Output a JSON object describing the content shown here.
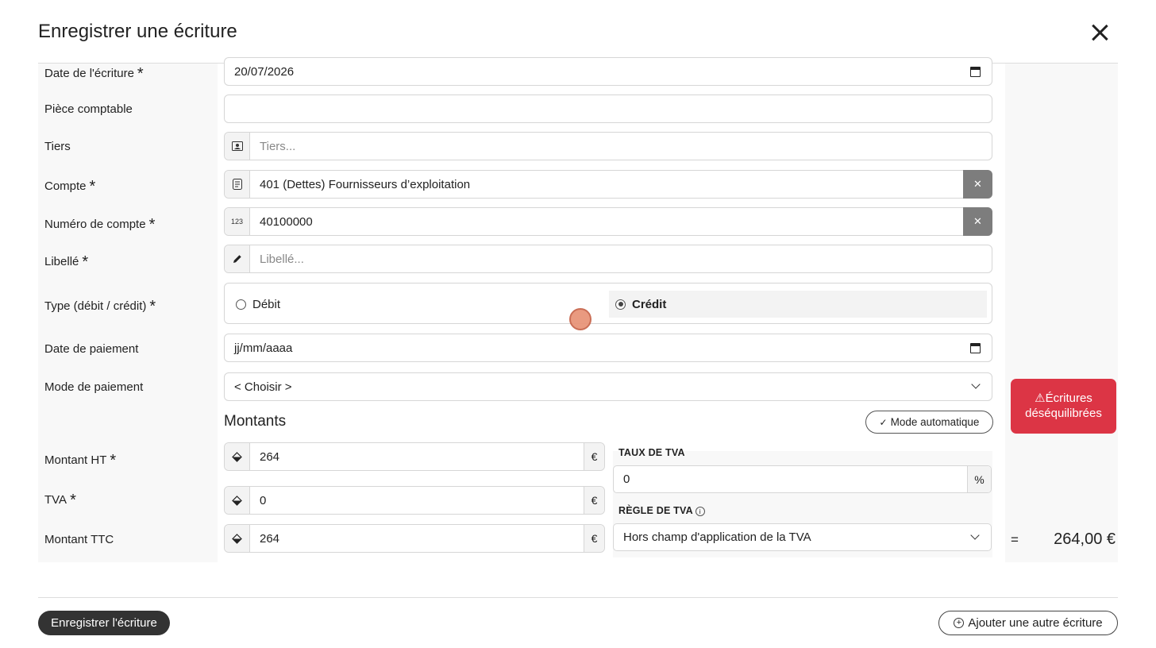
{
  "modal": {
    "title": "Enregistrer une écriture"
  },
  "fields": {
    "date_ecriture": {
      "label": "Date de l'écriture",
      "value": "20/07/2026"
    },
    "piece": {
      "label": "Pièce comptable",
      "value": ""
    },
    "tiers": {
      "label": "Tiers",
      "placeholder": "Tiers..."
    },
    "compte": {
      "label": "Compte",
      "value": "401 (Dettes) Fournisseurs d’exploitation"
    },
    "numero_compte": {
      "label": "Numéro de compte",
      "addon": "123",
      "value": "40100000"
    },
    "libelle": {
      "label": "Libellé",
      "placeholder": "Libellé..."
    },
    "type": {
      "label": "Type (débit / crédit)",
      "debit": "Débit",
      "credit": "Crédit",
      "selected": "credit"
    },
    "date_paiement": {
      "label": "Date de paiement",
      "placeholder": "jj/mm/aaaa"
    },
    "mode_paiement": {
      "label": "Mode de paiement",
      "value": "< Choisir >"
    }
  },
  "montants": {
    "title": "Montants",
    "auto_mode": "Mode automatique",
    "ht": {
      "label": "Montant HT",
      "value": "264",
      "unit": "€"
    },
    "tva": {
      "label": "TVA",
      "value": "0",
      "unit": "€"
    },
    "ttc": {
      "label": "Montant TTC",
      "value": "264",
      "unit": "€"
    },
    "taux_tva": {
      "label": "TAUX DE TVA",
      "value": "0",
      "unit": "%"
    },
    "regle_tva": {
      "label": "RÈGLE DE TVA",
      "value": "Hors champ d'application de la TVA"
    }
  },
  "alert": {
    "icon": "⚠",
    "line1": "Écritures",
    "line2": "déséquilibrées",
    "color": "#dc3545"
  },
  "total": {
    "equals": "=",
    "value": "264,00 €"
  },
  "footer": {
    "save": "Enregistrer l'écriture",
    "add_icon": "+",
    "add": "Ajouter une autre écriture"
  }
}
